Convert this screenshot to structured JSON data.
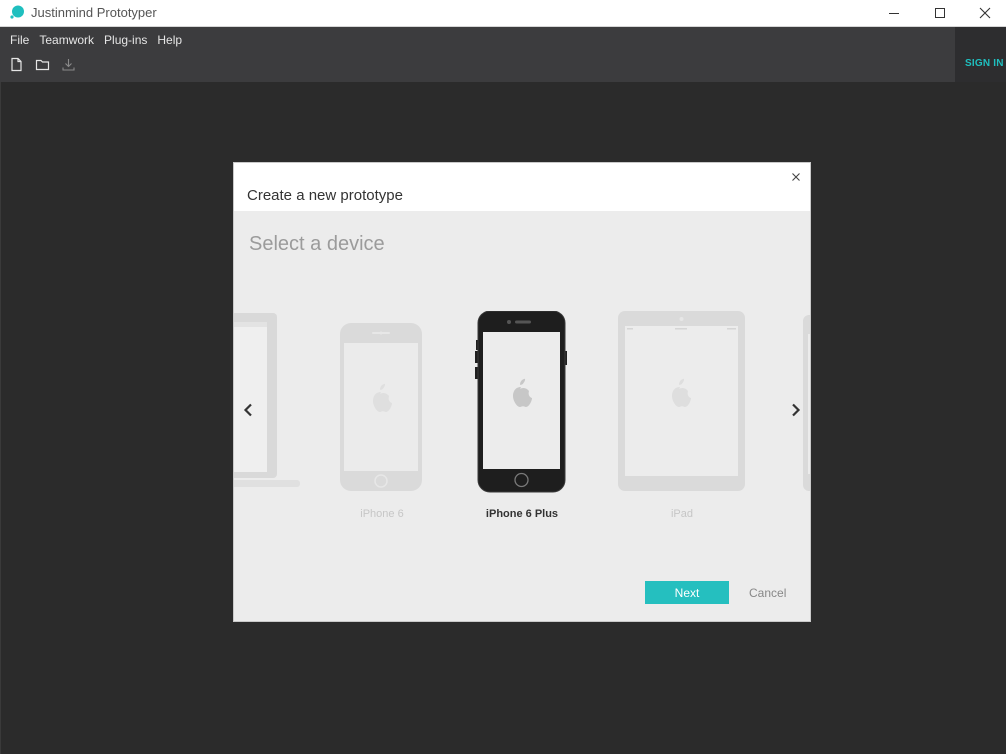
{
  "window": {
    "title": "Justinmind Prototyper",
    "brand_color": "#1fbfbf"
  },
  "menu": {
    "items": [
      {
        "label": "File"
      },
      {
        "label": "Teamwork"
      },
      {
        "label": "Plug-ins"
      },
      {
        "label": "Help"
      }
    ],
    "toolbar_icons": [
      "new-file-icon",
      "open-folder-icon",
      "download-icon"
    ],
    "sign_in": "SIGN IN"
  },
  "dialog": {
    "title": "Create a new prototype",
    "subtitle": "Select a device",
    "devices": [
      {
        "name": "",
        "icon": "laptop-icon",
        "selected": false
      },
      {
        "name": "iPhone 6",
        "icon": "phone-icon",
        "selected": false
      },
      {
        "name": "iPhone 6 Plus",
        "icon": "phone-icon",
        "selected": true
      },
      {
        "name": "iPad",
        "icon": "tablet-icon",
        "selected": false
      },
      {
        "name": "",
        "icon": "tablet-icon",
        "selected": false
      }
    ],
    "next_label": "Next",
    "cancel_label": "Cancel",
    "accent_color": "#25bfbf"
  }
}
